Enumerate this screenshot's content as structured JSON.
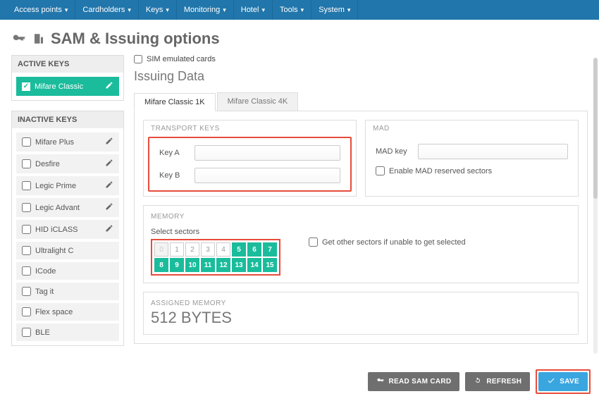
{
  "nav": {
    "items": [
      "Access points",
      "Cardholders",
      "Keys",
      "Monitoring",
      "Hotel",
      "Tools",
      "System"
    ]
  },
  "page": {
    "title": "SAM & Issuing options"
  },
  "left": {
    "active_header": "ACTIVE KEYS",
    "active_key": "Mifare Classic",
    "inactive_header": "INACTIVE KEYS",
    "inactive": [
      "Mifare Plus",
      "Desfire",
      "Legic Prime",
      "Legic Advant",
      "HID iCLASS",
      "Ultralight C",
      "ICode",
      "Tag it",
      "Flex space",
      "BLE"
    ]
  },
  "right": {
    "sim_label": "SIM emulated cards",
    "issuing_title": "Issuing Data",
    "tabs": [
      "Mifare Classic 1K",
      "Mifare Classic 4K"
    ],
    "transport_keys": {
      "header": "TRANSPORT KEYS",
      "keyA_label": "Key A",
      "keyA_value": "",
      "keyB_label": "Key B",
      "keyB_value": ""
    },
    "mad": {
      "header": "MAD",
      "madkey_label": "MAD key",
      "madkey_value": "",
      "enable_label": "Enable MAD reserved sectors"
    },
    "memory": {
      "header": "MEMORY",
      "select_label": "Select sectors",
      "sectors": [
        {
          "n": "0",
          "state": "dis"
        },
        {
          "n": "1",
          "state": ""
        },
        {
          "n": "2",
          "state": ""
        },
        {
          "n": "3",
          "state": ""
        },
        {
          "n": "4",
          "state": ""
        },
        {
          "n": "5",
          "state": "sel"
        },
        {
          "n": "6",
          "state": "sel"
        },
        {
          "n": "7",
          "state": "sel"
        },
        {
          "n": "8",
          "state": "sel"
        },
        {
          "n": "9",
          "state": "sel"
        },
        {
          "n": "10",
          "state": "sel"
        },
        {
          "n": "11",
          "state": "sel"
        },
        {
          "n": "12",
          "state": "sel"
        },
        {
          "n": "13",
          "state": "sel"
        },
        {
          "n": "14",
          "state": "sel"
        },
        {
          "n": "15",
          "state": "sel"
        }
      ],
      "get_other_label": "Get other sectors if unable to get selected",
      "assigned_header": "ASSIGNED MEMORY",
      "assigned_value": "512 BYTES"
    }
  },
  "footer": {
    "read": "READ SAM CARD",
    "refresh": "REFRESH",
    "save": "SAVE"
  }
}
